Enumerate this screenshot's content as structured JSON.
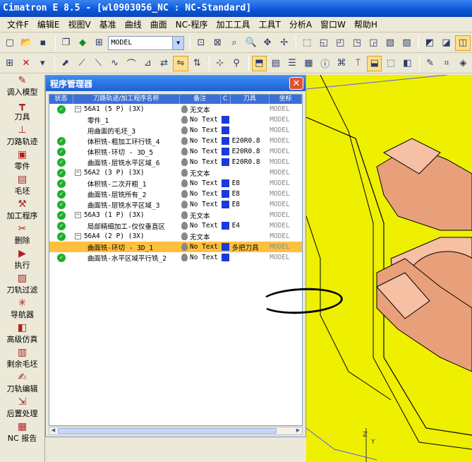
{
  "window": {
    "title": "Cimatron E 8.5 - [wl0903056_NC : NC-Standard]"
  },
  "menu": [
    "文件F",
    "编辑E",
    "视图V",
    "基准",
    "曲线",
    "曲面",
    "NC-程序",
    "加工工具",
    "工具T",
    "分析A",
    "窗口W",
    "帮助H"
  ],
  "toolbar": {
    "model_combo": "MODEL"
  },
  "sidebar": [
    {
      "label": "调入模型",
      "icon": "load-model-icon",
      "glyph": "✎"
    },
    {
      "label": "刀具",
      "icon": "tool-icon",
      "glyph": "┳"
    },
    {
      "label": "刀路轨迹",
      "icon": "toolpath-icon",
      "glyph": "⊥"
    },
    {
      "label": "零件",
      "icon": "part-icon",
      "glyph": "▣"
    },
    {
      "label": "毛坯",
      "icon": "stock-icon",
      "glyph": "▤"
    },
    {
      "label": "加工程序",
      "icon": "procedure-icon",
      "glyph": "⚒"
    },
    {
      "label": "删除",
      "icon": "delete-icon",
      "glyph": "✂"
    },
    {
      "label": "执行",
      "icon": "execute-icon",
      "glyph": "▶"
    },
    {
      "label": "刀轨过滤",
      "icon": "filter-icon",
      "glyph": "▨"
    },
    {
      "label": "导航器",
      "icon": "navigator-icon",
      "glyph": "✳"
    },
    {
      "label": "高级仿真",
      "icon": "simulation-icon",
      "glyph": "◧"
    },
    {
      "label": "剩余毛坯",
      "icon": "remaining-stock-icon",
      "glyph": "▥"
    },
    {
      "label": "刀轨编辑",
      "icon": "toolpath-edit-icon",
      "glyph": "✍"
    },
    {
      "label": "后置处理",
      "icon": "post-process-icon",
      "glyph": "⇲"
    },
    {
      "label": "NC 报告",
      "icon": "nc-report-icon",
      "glyph": "▦"
    }
  ],
  "panel": {
    "title": "程序管理器",
    "columns": [
      "状态",
      "刀路轨迹/加工程序名称",
      "备注",
      "C",
      "刀具",
      "坐标"
    ],
    "rows": [
      {
        "level": 0,
        "check": true,
        "name": "56A1    (5 P)  (3X)",
        "note": "无文本",
        "tool": "",
        "coord": "MODEL",
        "blue": false
      },
      {
        "level": 1,
        "check": false,
        "name": "零件_1",
        "note": "No Text",
        "tool": "",
        "coord": "MODEL",
        "blue": true
      },
      {
        "level": 1,
        "check": false,
        "name": "用曲面的毛坯_3",
        "note": "No Text",
        "tool": "",
        "coord": "MODEL",
        "blue": true
      },
      {
        "level": 1,
        "check": true,
        "name": "体积铣-粗加工环行铣_4",
        "note": "No Text",
        "tool": "E20R0.8",
        "coord": "MODEL",
        "blue": true
      },
      {
        "level": 1,
        "check": true,
        "name": "体积铣-环切 - 3D_5",
        "note": "No Text",
        "tool": "E20R0.8",
        "coord": "MODEL",
        "blue": true
      },
      {
        "level": 1,
        "check": true,
        "name": "曲面铣-层铣水平区域_6",
        "note": "No Text",
        "tool": "E20R0.8",
        "coord": "MODEL",
        "blue": true
      },
      {
        "level": 0,
        "check": true,
        "name": "56A2    (3 P)  (3X)",
        "note": "无文本",
        "tool": "",
        "coord": "MODEL",
        "blue": false
      },
      {
        "level": 1,
        "check": true,
        "name": "体积铣-二次开粗_1",
        "note": "No Text",
        "tool": "E8",
        "coord": "MODEL",
        "blue": true
      },
      {
        "level": 1,
        "check": true,
        "name": "曲面铣-层铣所有_2",
        "note": "No Text",
        "tool": "E8",
        "coord": "MODEL",
        "blue": true
      },
      {
        "level": 1,
        "check": true,
        "name": "曲面铣-层铣水平区域_3",
        "note": "No Text",
        "tool": "E8",
        "coord": "MODEL",
        "blue": true
      },
      {
        "level": 0,
        "check": true,
        "name": "56A3    (1 P)  (3X)",
        "note": "无文本",
        "tool": "",
        "coord": "MODEL",
        "blue": false
      },
      {
        "level": 1,
        "check": true,
        "name": "局部精细加工-仅仅垂直区",
        "note": "No Text",
        "tool": "E4",
        "coord": "MODEL",
        "blue": true
      },
      {
        "level": 0,
        "check": true,
        "name": "56A4    (2 P)  (3X)",
        "note": "无文本",
        "tool": "",
        "coord": "MODEL",
        "blue": false
      },
      {
        "level": 1,
        "check": false,
        "name": "曲面铣-环切 - 3D_1",
        "note": "No Text",
        "tool": "多把刀具",
        "coord": "MODEL",
        "blue": true,
        "selected": true
      },
      {
        "level": 1,
        "check": true,
        "name": "曲面铣-水平区域平行铣_2",
        "note": "No Text",
        "tool": "",
        "coord": "MODEL",
        "blue": true
      }
    ]
  },
  "colors": {
    "title_blue": "#0a55d8",
    "selection": "#ffc040",
    "viewport_yellow": "#eef000",
    "part_salmon": "#e8a07a",
    "check_green": "#1fae2d"
  }
}
